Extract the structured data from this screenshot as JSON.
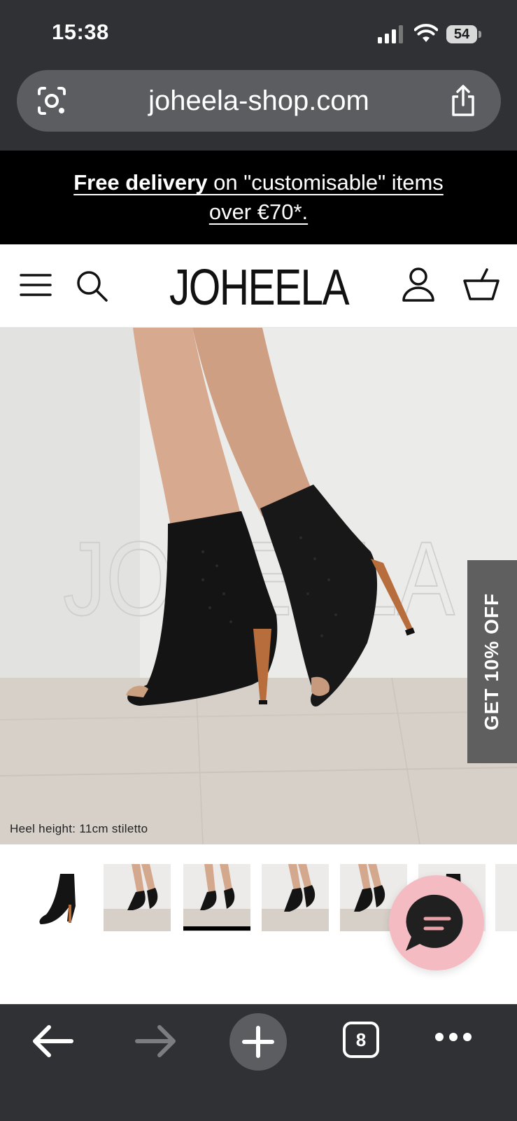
{
  "status_bar": {
    "time": "15:38",
    "battery": "54"
  },
  "browser": {
    "url": "joheela-shop.com",
    "tab_count": "8"
  },
  "promo": {
    "bold": "Free delivery",
    "rest_line1": " on \"customisable\" items",
    "line2": "over €70*."
  },
  "header": {
    "logo_text": "JOHEELA"
  },
  "hero": {
    "watermark": "JOHEELA",
    "caption": "Heel height: 11cm stiletto",
    "discount_tab": "GET 10% OFF"
  },
  "thumbnails": {
    "count": 7,
    "selected_index": 2
  },
  "icons": {
    "top": [
      "lens-icon",
      "share-icon",
      "menu-icon",
      "search-icon",
      "account-icon",
      "cart-icon"
    ],
    "bottom": [
      "back-arrow-icon",
      "forward-arrow-icon",
      "plus-icon",
      "tabs-icon",
      "more-icon"
    ],
    "chat": "chat-icon"
  },
  "colors": {
    "browser_chrome": "#2f3135",
    "url_bar": "#5b5d61",
    "promo_bg": "#000000",
    "discount_tab": "#5f5f5f",
    "chat_bubble": "#f4bcc2",
    "chat_icon_accent": "#e8a2a8"
  }
}
